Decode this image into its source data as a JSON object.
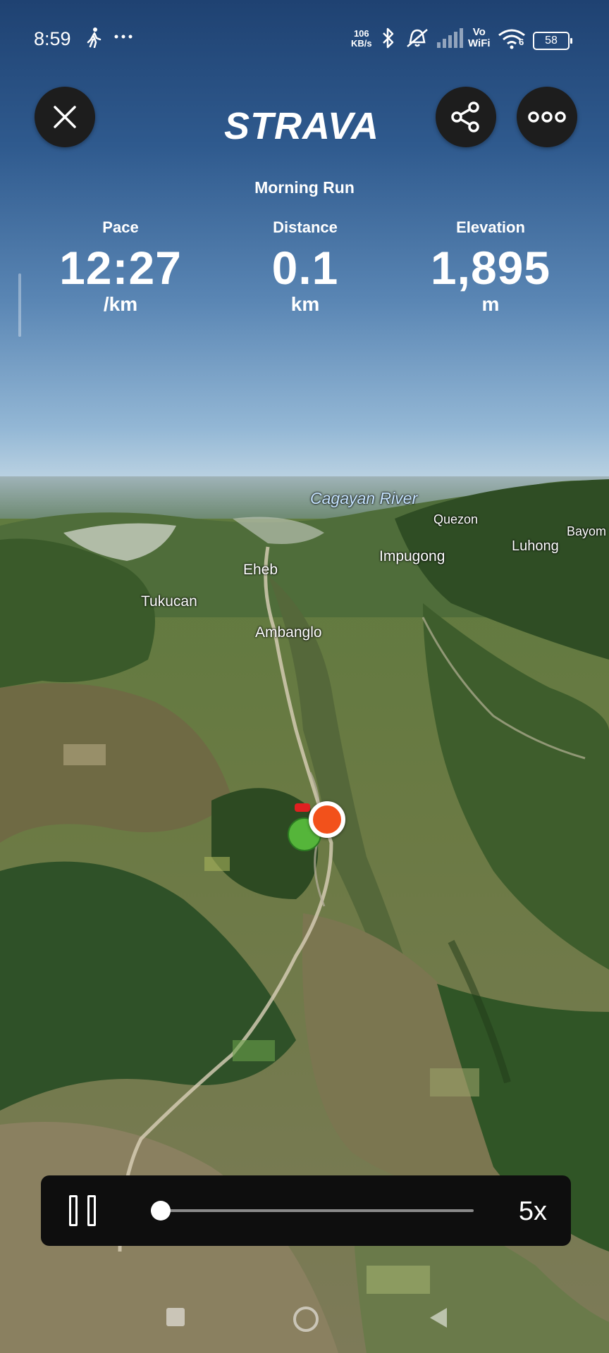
{
  "status_bar": {
    "time": "8:59",
    "network_speed_value": "106",
    "network_speed_unit": "KB/s",
    "vowifi_top": "Vo",
    "vowifi_bottom": "WiFi",
    "wifi_level": "6",
    "battery": "58"
  },
  "header": {
    "logo": "STRAVA",
    "activity_title": "Morning Run"
  },
  "stats": [
    {
      "label": "Pace",
      "value": "12:27",
      "unit": "/km"
    },
    {
      "label": "Distance",
      "value": "0.1",
      "unit": "km"
    },
    {
      "label": "Elevation",
      "value": "1,895",
      "unit": "m"
    }
  ],
  "map": {
    "places": {
      "river": "Cagayan River",
      "quezon": "Quezon",
      "bayom": "Bayom",
      "luhong": "Luhong",
      "impugong": "Impugong",
      "eheb": "Eheb",
      "tukucan": "Tukucan",
      "ambanglo": "Ambanglo"
    },
    "marker_colors": {
      "start": "#55b53a",
      "end": "#f2511b"
    }
  },
  "player": {
    "speed": "5x",
    "progress": 0.03
  },
  "icons": [
    "walk-icon",
    "more-dots-icon",
    "bluetooth-icon",
    "mute-icon",
    "signal-icon",
    "wifi-icon",
    "battery-icon",
    "close-icon",
    "share-icon",
    "more-icon",
    "pause-icon",
    "home-icon",
    "back-icon",
    "recent-apps-icon"
  ]
}
